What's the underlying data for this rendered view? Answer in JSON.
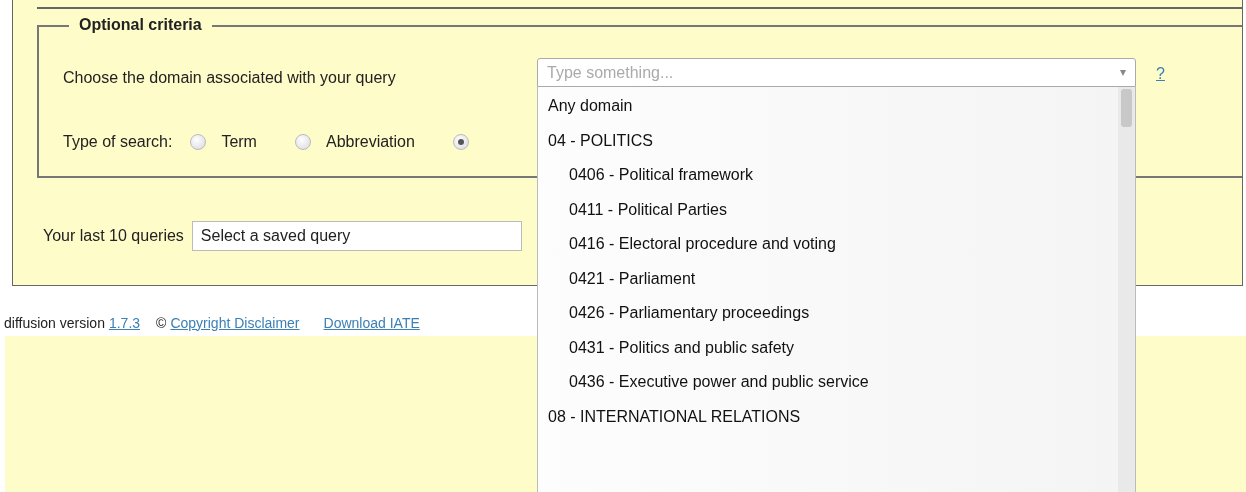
{
  "fieldset": {
    "legend": "Optional criteria",
    "domain_label": "Choose the domain associated with your query",
    "domain_field": {
      "placeholder": "Type something...",
      "caret": "▾"
    },
    "help_link": "?",
    "search_type_label": "Type of search:",
    "search_types": [
      {
        "label": "Term",
        "selected": false
      },
      {
        "label": "Abbreviation",
        "selected": false
      },
      {
        "selected": true
      }
    ]
  },
  "last_queries": {
    "label": "Your last 10 queries",
    "value": "Select a saved query"
  },
  "footer": {
    "version_text": "diffusion version",
    "version_link": "1.7.3",
    "copyright_sign": "©",
    "links": [
      "Copyright Disclaimer",
      "Download IATE"
    ]
  },
  "domain_list": [
    {
      "label": "Any domain"
    },
    {
      "label": "04 - POLITICS",
      "children": [
        {
          "label": "0406 - Political framework"
        },
        {
          "label": "0411 - Political Parties"
        },
        {
          "label": "0416 - Electoral procedure and voting"
        },
        {
          "label": "0421 - Parliament"
        },
        {
          "label": "0426 - Parliamentary proceedings"
        },
        {
          "label": "0431 - Politics and public safety"
        },
        {
          "label": "0436 - Executive power and public service"
        }
      ]
    },
    {
      "label": "08 - INTERNATIONAL RELATIONS"
    }
  ]
}
